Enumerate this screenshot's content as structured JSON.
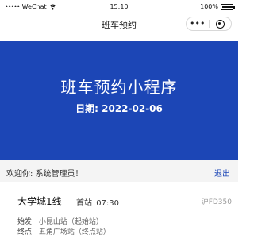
{
  "status_bar": {
    "signal": "•••••",
    "carrier": "WeChat",
    "time": "15:10",
    "battery_text": "100%",
    "battery_level": 1.0
  },
  "nav": {
    "title": "班车预约",
    "more": "•••"
  },
  "banner": {
    "title": "班车预约小程序",
    "date_label": "日期:",
    "date_value": "2022-02-06",
    "background": "#1c46b6"
  },
  "welcome": {
    "text": "欢迎你: 系统管理员！",
    "logout": "退出"
  },
  "route": {
    "name": "大学城1线",
    "first_label": "首站",
    "first_time": "07:30",
    "plate": "沪FD350",
    "start_kind": "始发",
    "start_place": "小昆山站（起始站）",
    "end_kind": "终点",
    "end_place": "五角广场站（终点站）"
  },
  "colors": {
    "accent": "#1c46b6",
    "welcome_bg": "#f4f4f4"
  }
}
